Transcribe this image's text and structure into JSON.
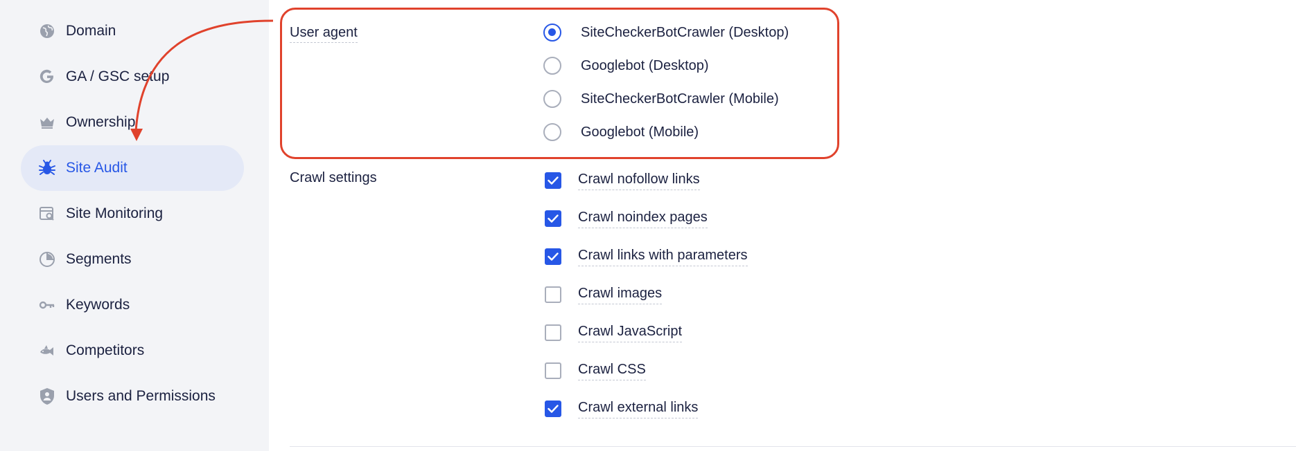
{
  "sidebar": {
    "items": [
      {
        "label": "Domain",
        "icon": "globe-icon"
      },
      {
        "label": "GA / GSC setup",
        "icon": "google-icon"
      },
      {
        "label": "Ownership",
        "icon": "crown-icon"
      },
      {
        "label": "Site Audit",
        "icon": "bug-icon",
        "active": true
      },
      {
        "label": "Site Monitoring",
        "icon": "monitoring-icon"
      },
      {
        "label": "Segments",
        "icon": "pie-chart-icon"
      },
      {
        "label": "Keywords",
        "icon": "key-icon"
      },
      {
        "label": "Competitors",
        "icon": "fish-icon"
      },
      {
        "label": "Users and Permissions",
        "icon": "shield-user-icon"
      }
    ]
  },
  "user_agent": {
    "label": "User agent",
    "options": [
      {
        "label": "SiteCheckerBotCrawler (Desktop)",
        "selected": true
      },
      {
        "label": "Googlebot (Desktop)",
        "selected": false
      },
      {
        "label": "SiteCheckerBotCrawler (Mobile)",
        "selected": false
      },
      {
        "label": "Googlebot (Mobile)",
        "selected": false
      }
    ]
  },
  "crawl_settings": {
    "label": "Crawl settings",
    "options": [
      {
        "label": "Crawl nofollow links",
        "checked": true
      },
      {
        "label": "Crawl noindex pages",
        "checked": true
      },
      {
        "label": "Crawl links with parameters",
        "checked": true
      },
      {
        "label": "Crawl images",
        "checked": false
      },
      {
        "label": "Crawl JavaScript",
        "checked": false
      },
      {
        "label": "Crawl CSS",
        "checked": false
      },
      {
        "label": "Crawl external links",
        "checked": true
      }
    ]
  },
  "colors": {
    "accent": "#2757e6",
    "annotation": "#e0422c",
    "sidebar_bg": "#f3f4f7",
    "active_bg": "#e4e9f7"
  }
}
